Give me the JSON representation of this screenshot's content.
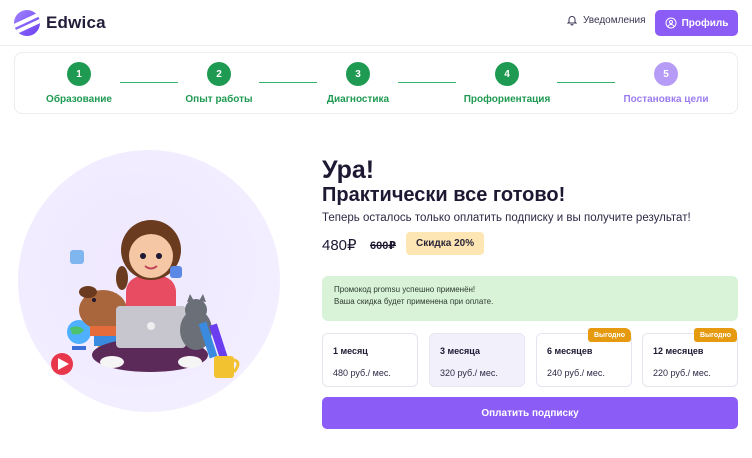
{
  "header": {
    "logo_text": "Edwica",
    "notifications_label": "Уведомления",
    "profile_label": "Профиль"
  },
  "steps": [
    {
      "num": "1",
      "label": "Образование",
      "state": "done"
    },
    {
      "num": "2",
      "label": "Опыт работы",
      "state": "done"
    },
    {
      "num": "3",
      "label": "Диагностика",
      "state": "done"
    },
    {
      "num": "4",
      "label": "Профориентация",
      "state": "done"
    },
    {
      "num": "5",
      "label": "Постановка цели",
      "state": "active"
    }
  ],
  "main": {
    "title": "Ура!",
    "subtitle": "Практически все готово!",
    "description": "Теперь осталось только оплатить подписку и вы получите результат!",
    "price": "480₽",
    "old_price": "600₽",
    "discount": "Скидка 20%",
    "promo_line1": "Промокод promsu успешно применён!",
    "promo_line2": "Ваша скидка будет применена при оплате.",
    "plans": [
      {
        "title": "1 месяц",
        "price": "480 руб./ мес.",
        "badge": ""
      },
      {
        "title": "3 месяца",
        "price": "320 руб./ мес.",
        "badge": ""
      },
      {
        "title": "6 месяцев",
        "price": "240 руб./ мес.",
        "badge": "Выгодно"
      },
      {
        "title": "12 месяцев",
        "price": "220 руб./ мес.",
        "badge": "Выгодно"
      }
    ],
    "selected_plan": "3 месяца",
    "pay_button": "Оплатить подписку"
  },
  "colors": {
    "accent": "#8b5cf6",
    "step_done": "#1f9a52",
    "step_active": "#b79cf7",
    "promo_bg": "#d9f3d9",
    "discount_bg": "#fde6b3",
    "badge": "#e59a10"
  },
  "icons": {
    "logo": "edwica-logo-icon",
    "notifications": "bell-icon",
    "profile": "user-icon"
  }
}
